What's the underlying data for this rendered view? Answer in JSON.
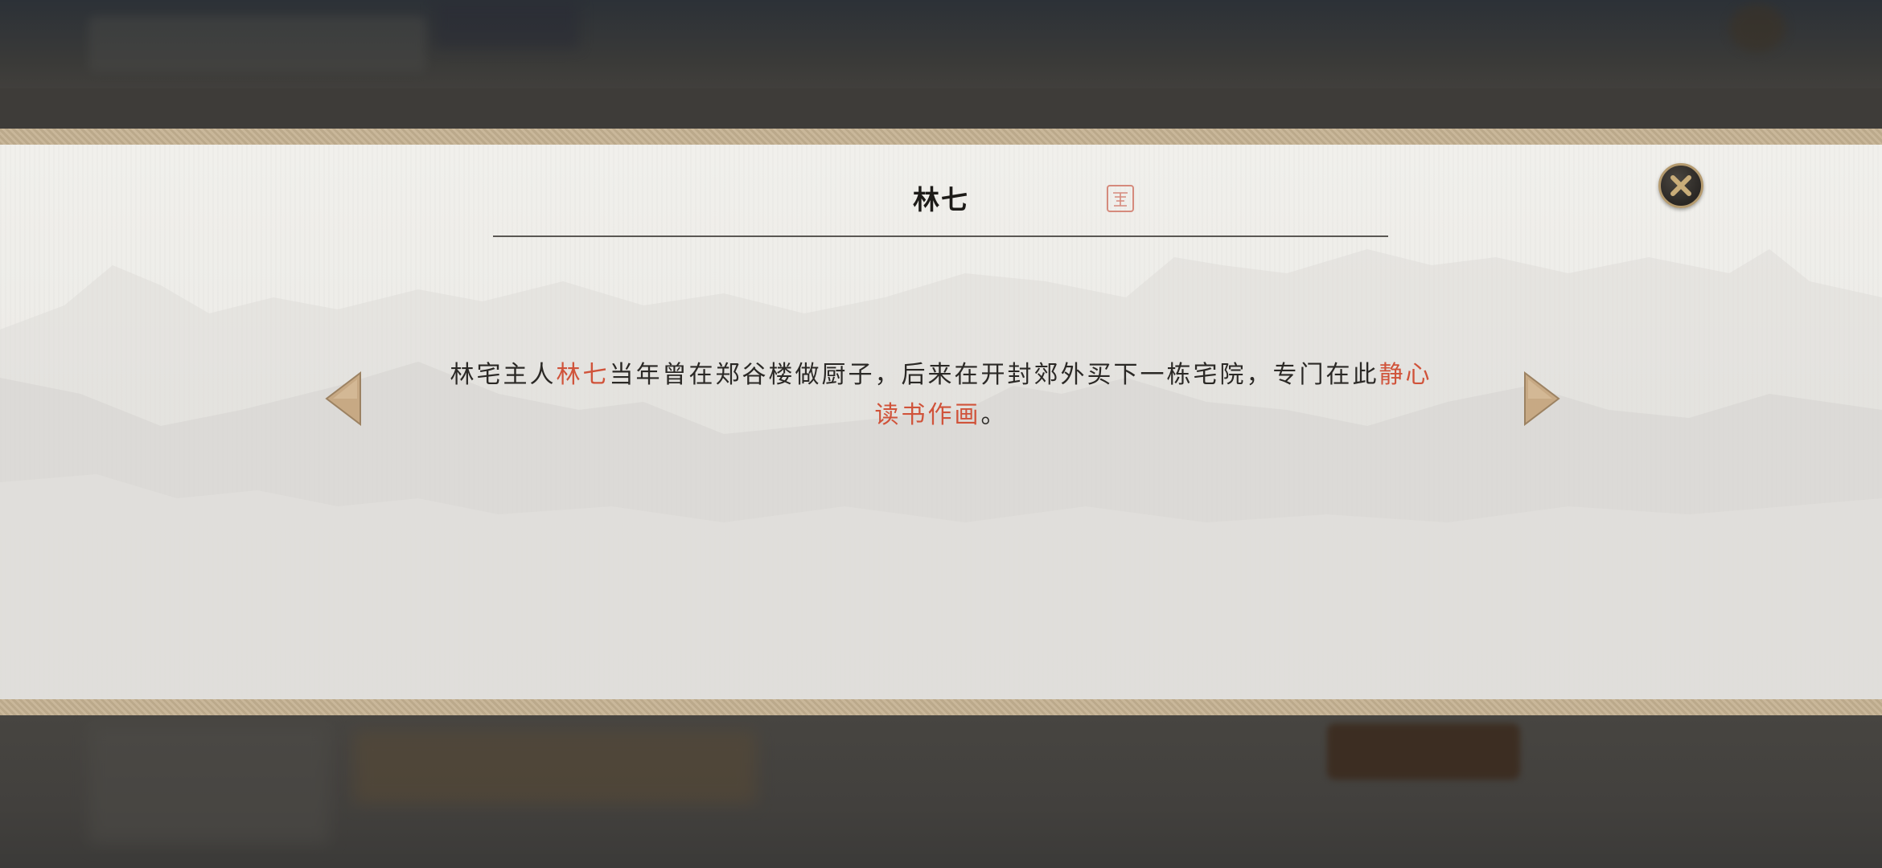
{
  "dialog": {
    "title": "林七",
    "description_segments": [
      {
        "text": "林宅主人",
        "highlight": false
      },
      {
        "text": "林七",
        "highlight": true
      },
      {
        "text": "当年曾在郑谷楼做厨子，后来在开封郊外买下一栋宅院，专门在此",
        "highlight": false
      },
      {
        "text": "静心读书作画",
        "highlight": true
      },
      {
        "text": "。",
        "highlight": false
      }
    ],
    "highlight_color": "#d0533a",
    "border_color": "#bba98b"
  },
  "controls": {
    "close_icon": "close-x-icon",
    "prev_icon": "triangle-left-icon",
    "next_icon": "triangle-right-icon"
  },
  "decorations": {
    "seal_icon": "red-seal-stamp-icon",
    "background": "ink-mountain-landscape"
  }
}
